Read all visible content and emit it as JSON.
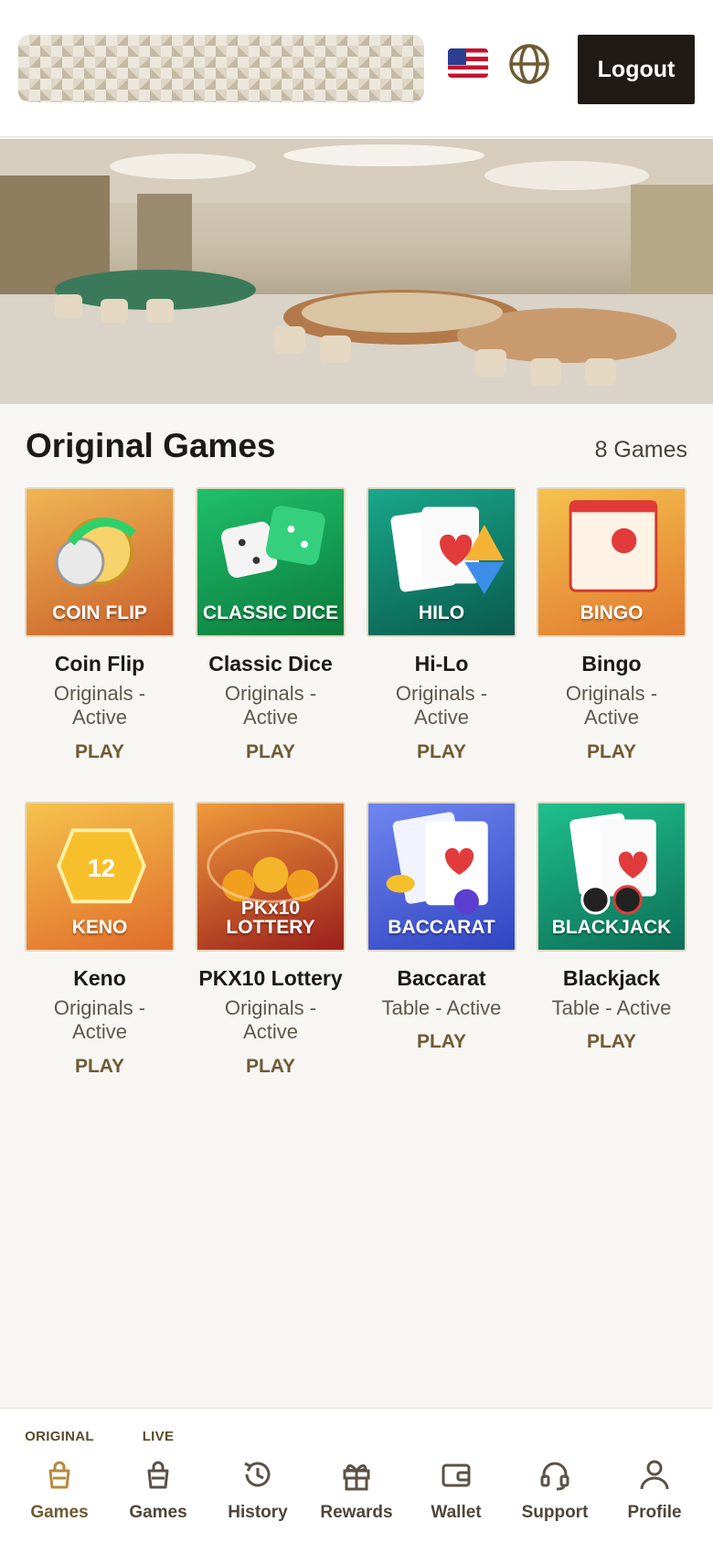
{
  "header": {
    "logout_label": "Logout",
    "flag_icon": "us-flag-icon",
    "language_icon": "globe-icon"
  },
  "section": {
    "title": "Original Games",
    "count": "8 Games"
  },
  "games": [
    {
      "name": "Coin Flip",
      "meta": "Originals - Active",
      "play": "PLAY",
      "thumb_label": "COIN FLIP",
      "color_top": "#f0b553",
      "color_bottom": "#c9602a"
    },
    {
      "name": "Classic Dice",
      "meta": "Originals - Active",
      "play": "PLAY",
      "thumb_label": "CLASSIC DICE",
      "color_top": "#1fc06b",
      "color_bottom": "#0b7a3c"
    },
    {
      "name": "Hi-Lo",
      "meta": "Originals - Active",
      "play": "PLAY",
      "thumb_label": "HILO",
      "color_top": "#19a88a",
      "color_bottom": "#0a5a4e"
    },
    {
      "name": "Bingo",
      "meta": "Originals - Active",
      "play": "PLAY",
      "thumb_label": "BINGO",
      "color_top": "#f5c24f",
      "color_bottom": "#e0782e"
    },
    {
      "name": "Keno",
      "meta": "Originals - Active",
      "play": "PLAY",
      "thumb_label": "KENO",
      "color_top": "#f6c24d",
      "color_bottom": "#df6c2a"
    },
    {
      "name": "PKX10 Lottery",
      "meta": "Originals - Active",
      "play": "PLAY",
      "thumb_label": "PKx10 LOTTERY",
      "color_top": "#ef9a3a",
      "color_bottom": "#9c1f1c"
    },
    {
      "name": "Baccarat",
      "meta": "Table - Active",
      "play": "PLAY",
      "thumb_label": "BACCARAT",
      "color_top": "#6f86ef",
      "color_bottom": "#3145c2"
    },
    {
      "name": "Blackjack",
      "meta": "Table - Active",
      "play": "PLAY",
      "thumb_label": "BLACKJACK",
      "color_top": "#1ec08c",
      "color_bottom": "#0d6f57"
    }
  ],
  "nav": [
    {
      "caption": "ORIGINAL",
      "label": "Games",
      "icon": "shopping-bag-icon"
    },
    {
      "caption": "LIVE",
      "label": "Games",
      "icon": "shopping-bag-icon"
    },
    {
      "caption": "",
      "label": "History",
      "icon": "history-icon"
    },
    {
      "caption": "",
      "label": "Rewards",
      "icon": "gift-icon"
    },
    {
      "caption": "",
      "label": "Wallet",
      "icon": "wallet-icon"
    },
    {
      "caption": "",
      "label": "Support",
      "icon": "headset-icon"
    },
    {
      "caption": "",
      "label": "Profile",
      "icon": "user-icon"
    }
  ],
  "colors": {
    "accent": "#6f5a33",
    "logout_bg": "#1f1a15"
  }
}
